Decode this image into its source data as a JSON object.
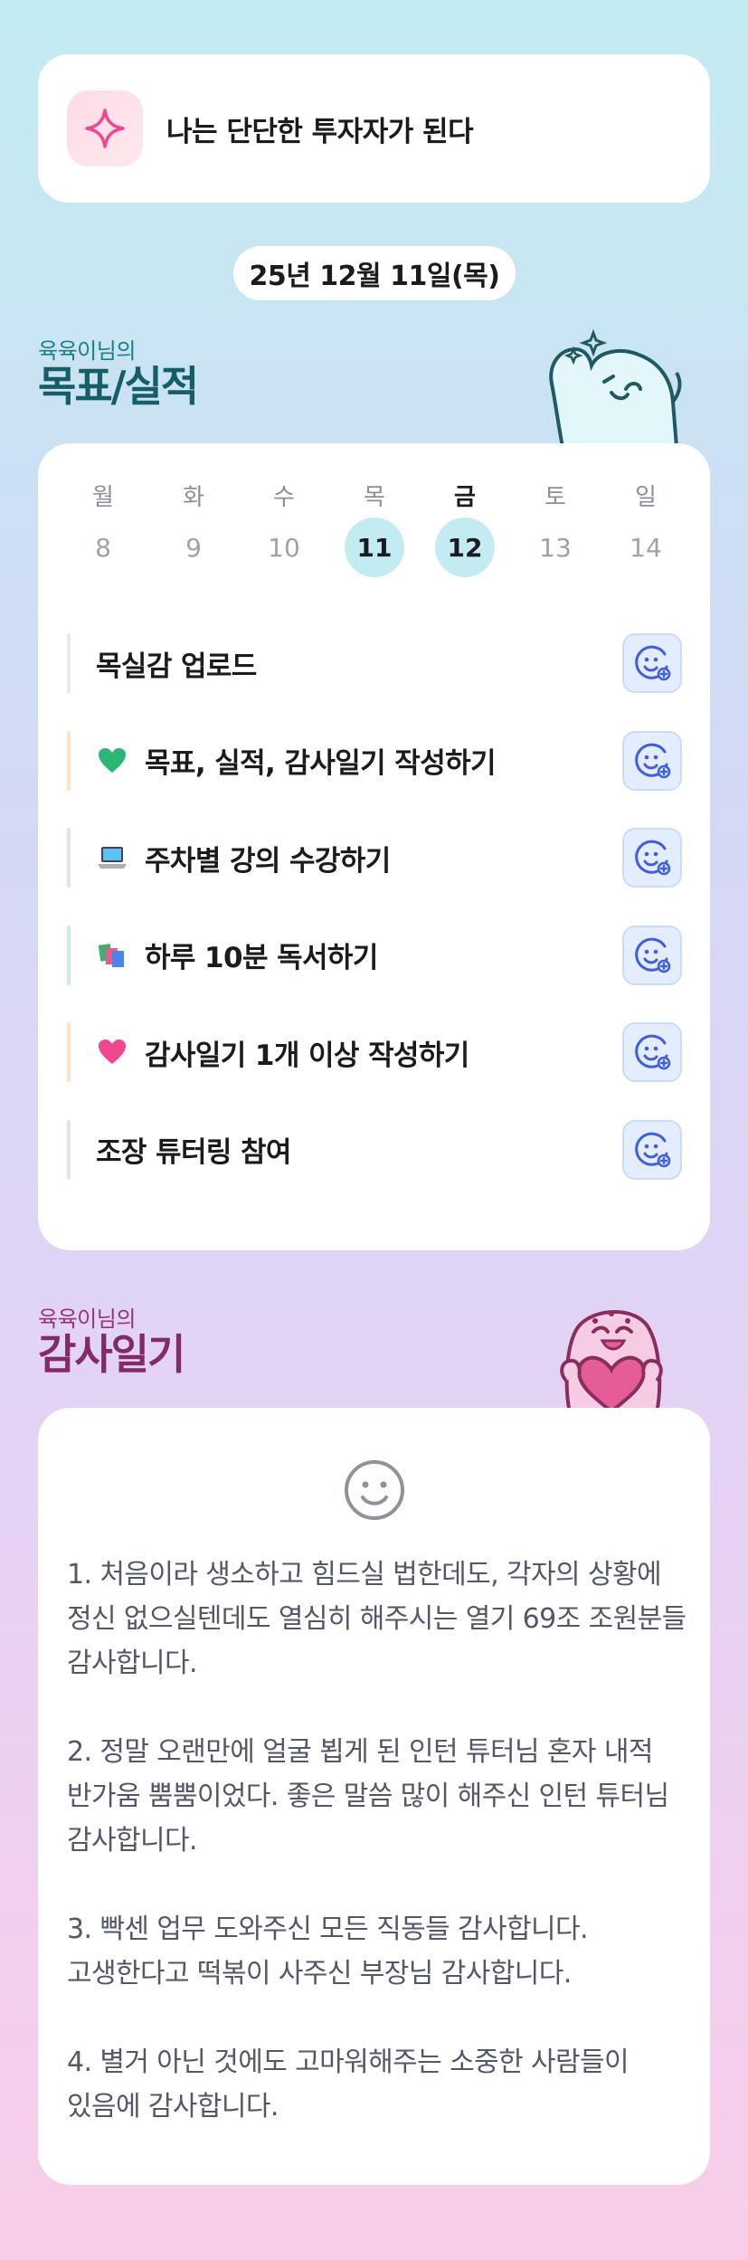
{
  "goal": {
    "icon": "sparkle-icon",
    "text": "나는 단단한 투자자가 된다"
  },
  "date_label": "25년 12월 11일(목)",
  "goals_section": {
    "subtitle": "육육이님의",
    "title": "목표/실적"
  },
  "week": {
    "days": [
      {
        "dow": "월",
        "num": "8",
        "bold": false,
        "active": false
      },
      {
        "dow": "화",
        "num": "9",
        "bold": false,
        "active": false
      },
      {
        "dow": "수",
        "num": "10",
        "bold": false,
        "active": false
      },
      {
        "dow": "목",
        "num": "11",
        "bold": false,
        "active": true
      },
      {
        "dow": "금",
        "num": "12",
        "bold": true,
        "active": true
      },
      {
        "dow": "토",
        "num": "13",
        "bold": false,
        "active": false
      },
      {
        "dow": "일",
        "num": "14",
        "bold": false,
        "active": false
      }
    ]
  },
  "tasks": [
    {
      "label": "목실감 업로드",
      "emoji": "",
      "bar_color": "#e7e8ee",
      "action_icon": "smiley-add-icon"
    },
    {
      "label": "목표, 실적, 감사일기 작성하기",
      "emoji": "green-heart-icon",
      "bar_color": "#fde3c3",
      "action_icon": "smiley-add-icon"
    },
    {
      "label": "주차별 강의 수강하기",
      "emoji": "laptop-icon",
      "bar_color": "#dfe2f6",
      "action_icon": "smiley-add-icon"
    },
    {
      "label": "하루 10분 독서하기",
      "emoji": "books-icon",
      "bar_color": "#cfeee1",
      "action_icon": "smiley-add-icon"
    },
    {
      "label": "감사일기 1개 이상 작성하기",
      "emoji": "pink-heart-icon",
      "bar_color": "#fde3c3",
      "action_icon": "smiley-add-icon"
    },
    {
      "label": "조장 튜터링 참여",
      "emoji": "",
      "bar_color": "#dfe2f6",
      "action_icon": "smiley-add-icon"
    }
  ],
  "diary_section": {
    "subtitle": "육육이님의",
    "title": "감사일기"
  },
  "diary": {
    "icon": "smiley-face-icon",
    "text": "1. 처음이라 생소하고 힘드실 법한데도, 각자의 상황에 정신 없으실텐데도 열심히 해주시는 열기 69조 조원분들 감사합니다.\n\n2. 정말 오랜만에 얼굴 뵙게 된 인턴 튜터님 혼자 내적 반가움 뿜뿜이었다. 좋은 말씀 많이 해주신 인턴 튜터님 감사합니다.\n\n3. 빡센 업무 도와주신 모든 직동들 감사합니다. 고생한다고 떡볶이 사주신 부장님 감사합니다.\n\n4. 별거 아닌 것에도 고마워해주는 소중한 사람들이 있음에 감사합니다."
  },
  "colors": {
    "teal_title": "#135e67",
    "plum_title": "#822c63",
    "active_day": "#c2ecf1",
    "action_icon": "#3f5fe0"
  }
}
